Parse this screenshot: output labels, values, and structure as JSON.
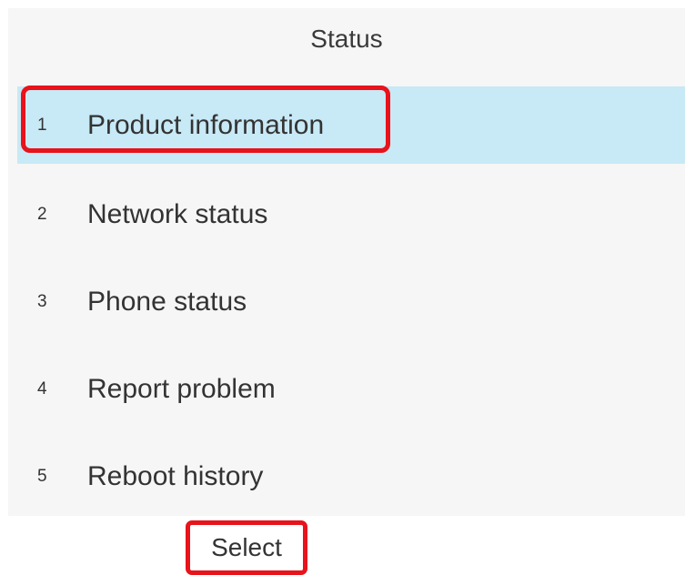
{
  "header": {
    "title": "Status"
  },
  "menu": {
    "items": [
      {
        "number": "1",
        "label": "Product information",
        "selected": true
      },
      {
        "number": "2",
        "label": "Network status",
        "selected": false
      },
      {
        "number": "3",
        "label": "Phone status",
        "selected": false
      },
      {
        "number": "4",
        "label": "Report problem",
        "selected": false
      },
      {
        "number": "5",
        "label": "Reboot history",
        "selected": false
      }
    ]
  },
  "softkeys": {
    "select_label": "Select"
  },
  "colors": {
    "selected_row": "#c8e9f6",
    "annotation_red": "#e8131b",
    "screen_background": "#f6f6f6"
  }
}
